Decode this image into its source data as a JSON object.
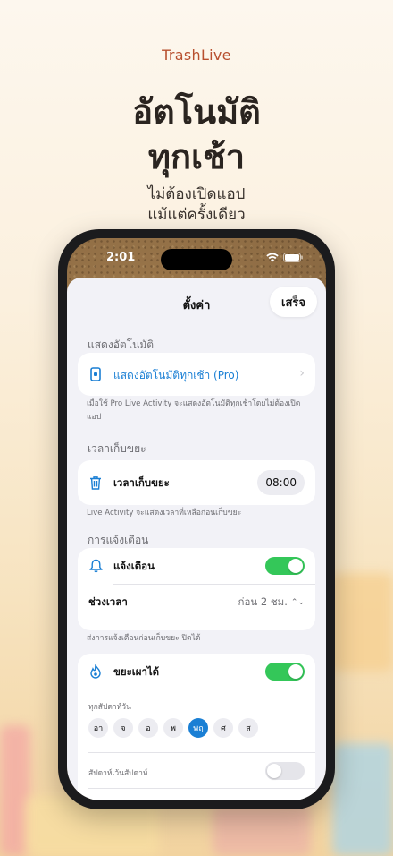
{
  "brand": "TrashLive",
  "headline": [
    "อัตโนมัติ",
    "ทุกเช้า"
  ],
  "subline": [
    "ไม่ต้องเปิดแอป",
    "แม้แต่ครั้งเดียว"
  ],
  "status": {
    "time": "2:01"
  },
  "sheet": {
    "title": "ตั้งค่า",
    "done_label": "เสร็จ",
    "auto_section": {
      "header": "แสดงอัตโนมัติ",
      "row_label": "แสดงอัตโนมัติทุกเช้า (Pro)",
      "footer": "เมื่อใช้ Pro Live Activity จะแสดงอัตโนมัติทุกเช้าโดยไม่ต้องเปิดแอป"
    },
    "pickup_section": {
      "header": "เวลาเก็บขยะ",
      "row_label": "เวลาเก็บขยะ",
      "time_value": "08:00",
      "footer": "Live Activity จะแสดงเวลาที่เหลือก่อนเก็บขยะ"
    },
    "notify_section": {
      "header": "การแจ้งเตือน",
      "toggle_label": "แจ้งเตือน",
      "toggle_on": true,
      "period_label": "ช่วงเวลา",
      "period_value": "ก่อน 2 ชม.",
      "footer": "ส่งการแจ้งเตือนก่อนเก็บขยะ ปิดได้"
    },
    "burnable_section": {
      "toggle_label": "ขยะเผาได้",
      "toggle_on": true,
      "weekly_label": "ทุกสัปดาห์วัน",
      "days": [
        "อา",
        "จ",
        "อ",
        "พ",
        "พฤ",
        "ศ",
        "ส"
      ],
      "selected_day": "พฤ",
      "weekly_except_label": "สัปดาห์เว้นสัปดาห์",
      "weekly_except_on": false
    }
  },
  "colors": {
    "accent": "#1a7fd4",
    "toggle_on": "#34c759",
    "brand": "#b8502f"
  }
}
